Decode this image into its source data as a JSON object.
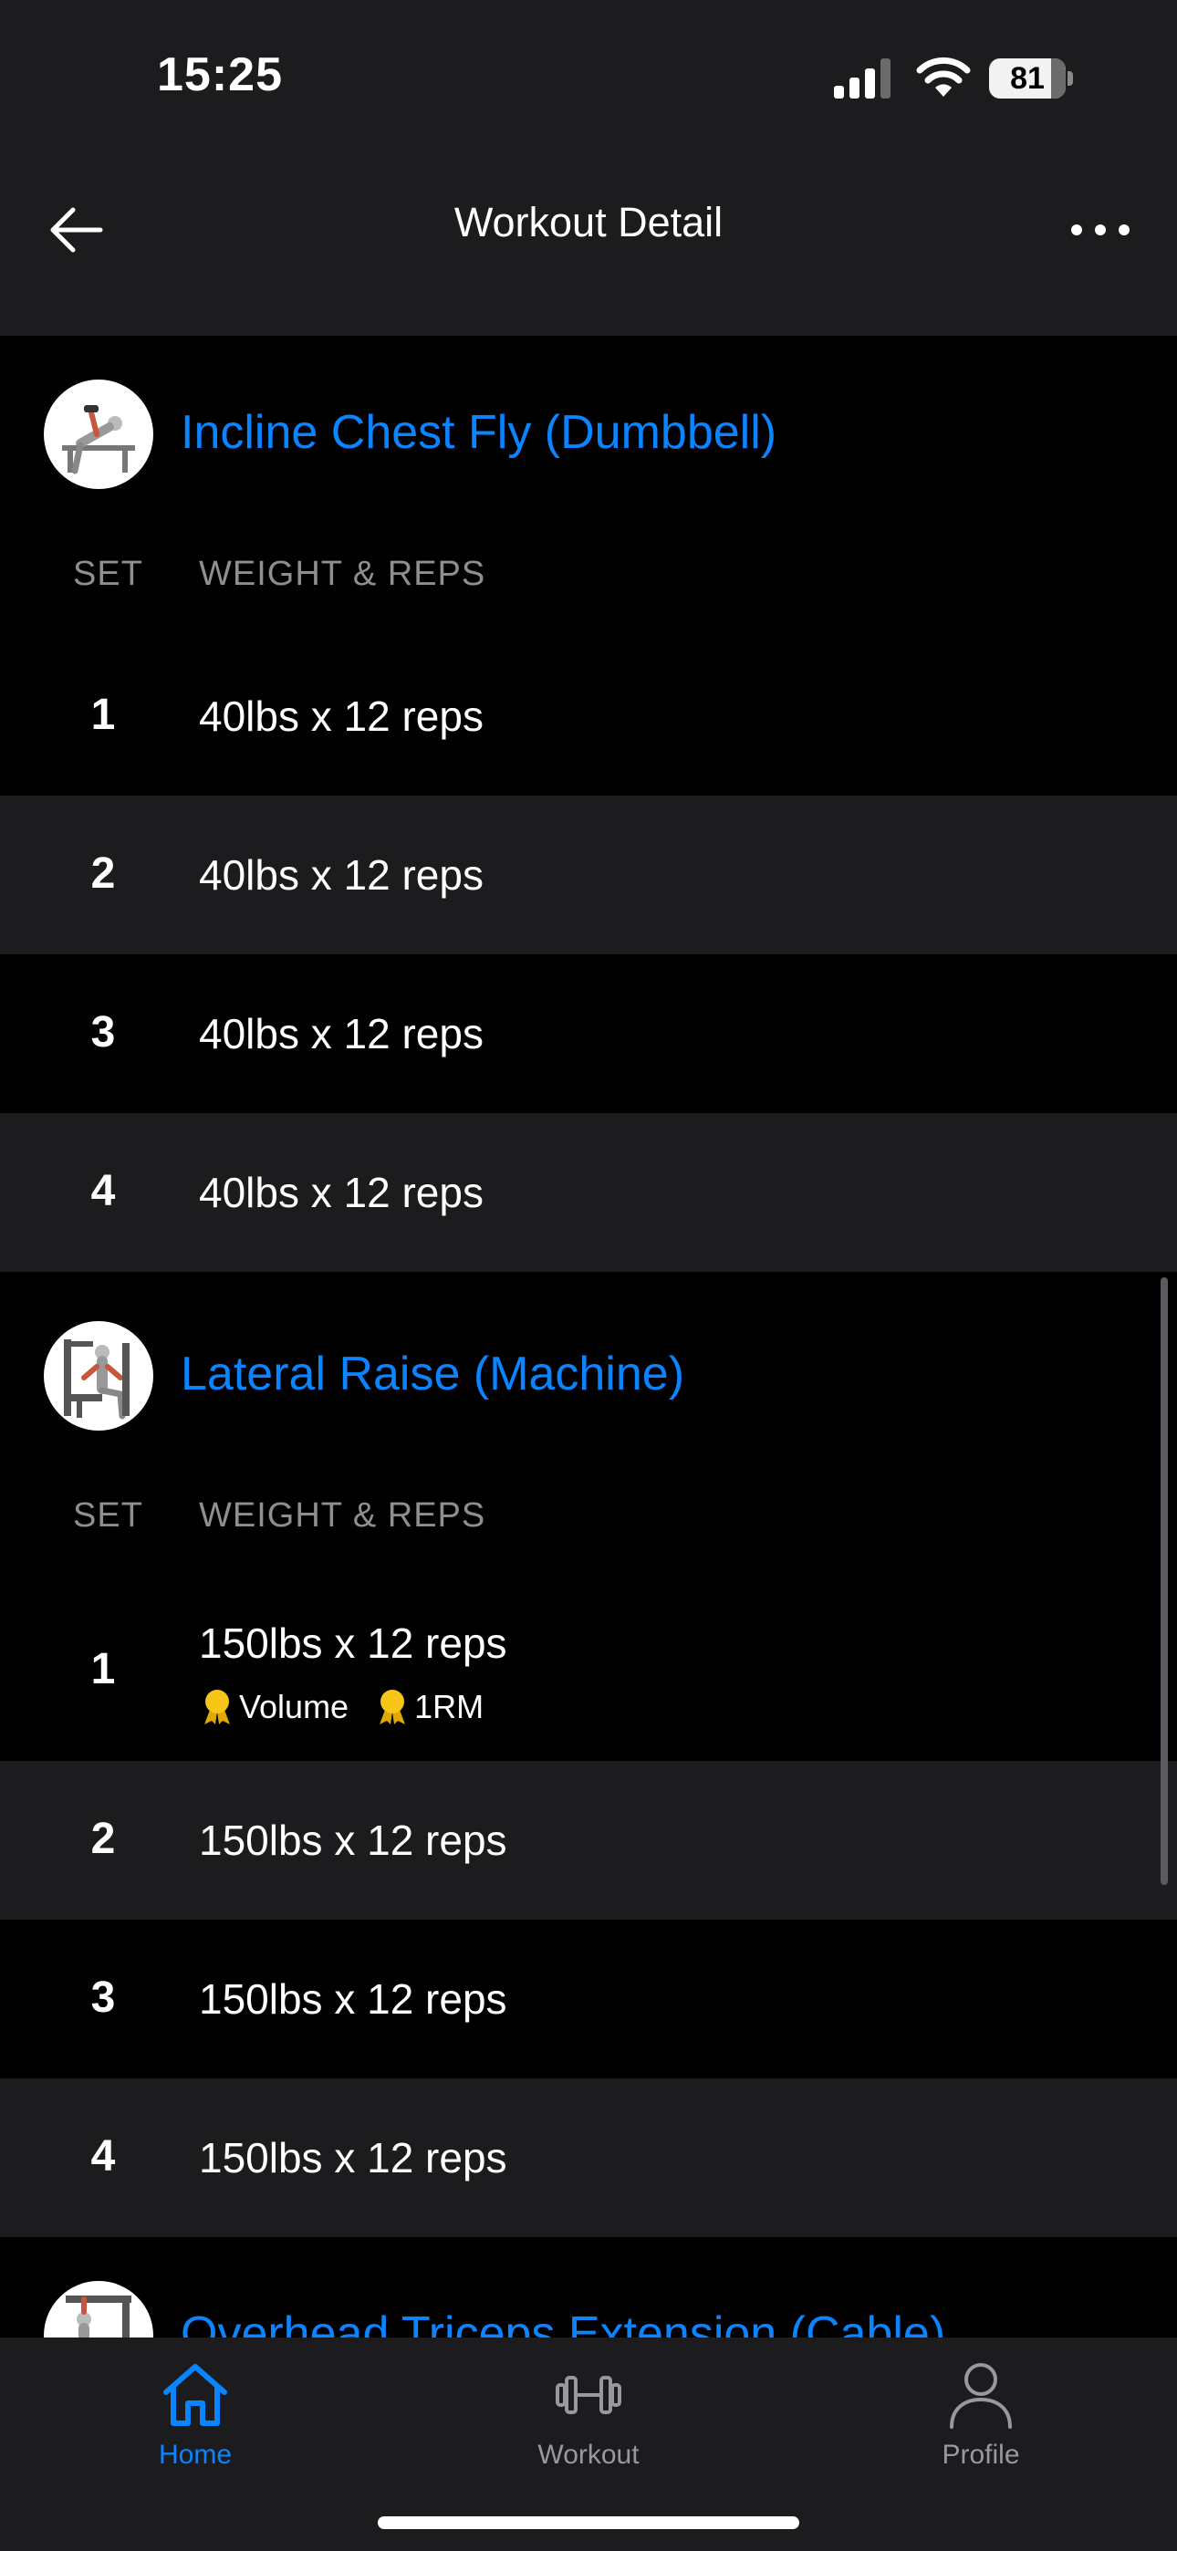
{
  "status_bar": {
    "time": "15:25",
    "battery": "81",
    "battery_level": 0.81
  },
  "nav": {
    "title": "Workout Detail",
    "back_icon": "arrow-left-icon",
    "more_icon": "ellipsis-icon"
  },
  "columns": {
    "set": "SET",
    "weight_reps": "WEIGHT & REPS"
  },
  "exercises": [
    {
      "name": "Incline Chest Fly (Dumbbell)",
      "sets": [
        {
          "num": "1",
          "text": "40lbs x 12 reps"
        },
        {
          "num": "2",
          "text": "40lbs x 12 reps"
        },
        {
          "num": "3",
          "text": "40lbs x 12 reps"
        },
        {
          "num": "4",
          "text": "40lbs x 12 reps"
        }
      ]
    },
    {
      "name": "Lateral Raise (Machine)",
      "sets": [
        {
          "num": "1",
          "text": "150lbs x 12 reps",
          "badges": [
            "Volume",
            "1RM"
          ]
        },
        {
          "num": "2",
          "text": "150lbs x 12 reps"
        },
        {
          "num": "3",
          "text": "150lbs x 12 reps"
        },
        {
          "num": "4",
          "text": "150lbs x 12 reps"
        }
      ]
    },
    {
      "name": "Overhead Triceps Extension (Cable)"
    }
  ],
  "tabs": [
    {
      "label": "Home",
      "icon": "home-icon",
      "active": true
    },
    {
      "label": "Workout",
      "icon": "dumbbell-icon",
      "active": false
    },
    {
      "label": "Profile",
      "icon": "person-icon",
      "active": false
    }
  ],
  "colors": {
    "accent": "#0a84ff",
    "background": "#000000",
    "surface": "#1c1c1e",
    "badge": "#f5c518"
  }
}
